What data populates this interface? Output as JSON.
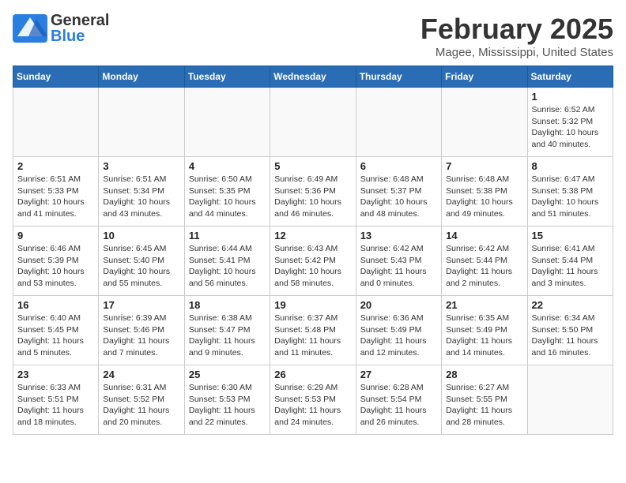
{
  "header": {
    "logo": {
      "general": "General",
      "blue": "Blue"
    },
    "title": "February 2025",
    "subtitle": "Magee, Mississippi, United States"
  },
  "weekdays": [
    "Sunday",
    "Monday",
    "Tuesday",
    "Wednesday",
    "Thursday",
    "Friday",
    "Saturday"
  ],
  "weeks": [
    [
      {
        "day": "",
        "info": ""
      },
      {
        "day": "",
        "info": ""
      },
      {
        "day": "",
        "info": ""
      },
      {
        "day": "",
        "info": ""
      },
      {
        "day": "",
        "info": ""
      },
      {
        "day": "",
        "info": ""
      },
      {
        "day": "1",
        "info": "Sunrise: 6:52 AM\nSunset: 5:32 PM\nDaylight: 10 hours and 40 minutes."
      }
    ],
    [
      {
        "day": "2",
        "info": "Sunrise: 6:51 AM\nSunset: 5:33 PM\nDaylight: 10 hours and 41 minutes."
      },
      {
        "day": "3",
        "info": "Sunrise: 6:51 AM\nSunset: 5:34 PM\nDaylight: 10 hours and 43 minutes."
      },
      {
        "day": "4",
        "info": "Sunrise: 6:50 AM\nSunset: 5:35 PM\nDaylight: 10 hours and 44 minutes."
      },
      {
        "day": "5",
        "info": "Sunrise: 6:49 AM\nSunset: 5:36 PM\nDaylight: 10 hours and 46 minutes."
      },
      {
        "day": "6",
        "info": "Sunrise: 6:48 AM\nSunset: 5:37 PM\nDaylight: 10 hours and 48 minutes."
      },
      {
        "day": "7",
        "info": "Sunrise: 6:48 AM\nSunset: 5:38 PM\nDaylight: 10 hours and 49 minutes."
      },
      {
        "day": "8",
        "info": "Sunrise: 6:47 AM\nSunset: 5:38 PM\nDaylight: 10 hours and 51 minutes."
      }
    ],
    [
      {
        "day": "9",
        "info": "Sunrise: 6:46 AM\nSunset: 5:39 PM\nDaylight: 10 hours and 53 minutes."
      },
      {
        "day": "10",
        "info": "Sunrise: 6:45 AM\nSunset: 5:40 PM\nDaylight: 10 hours and 55 minutes."
      },
      {
        "day": "11",
        "info": "Sunrise: 6:44 AM\nSunset: 5:41 PM\nDaylight: 10 hours and 56 minutes."
      },
      {
        "day": "12",
        "info": "Sunrise: 6:43 AM\nSunset: 5:42 PM\nDaylight: 10 hours and 58 minutes."
      },
      {
        "day": "13",
        "info": "Sunrise: 6:42 AM\nSunset: 5:43 PM\nDaylight: 11 hours and 0 minutes."
      },
      {
        "day": "14",
        "info": "Sunrise: 6:42 AM\nSunset: 5:44 PM\nDaylight: 11 hours and 2 minutes."
      },
      {
        "day": "15",
        "info": "Sunrise: 6:41 AM\nSunset: 5:44 PM\nDaylight: 11 hours and 3 minutes."
      }
    ],
    [
      {
        "day": "16",
        "info": "Sunrise: 6:40 AM\nSunset: 5:45 PM\nDaylight: 11 hours and 5 minutes."
      },
      {
        "day": "17",
        "info": "Sunrise: 6:39 AM\nSunset: 5:46 PM\nDaylight: 11 hours and 7 minutes."
      },
      {
        "day": "18",
        "info": "Sunrise: 6:38 AM\nSunset: 5:47 PM\nDaylight: 11 hours and 9 minutes."
      },
      {
        "day": "19",
        "info": "Sunrise: 6:37 AM\nSunset: 5:48 PM\nDaylight: 11 hours and 11 minutes."
      },
      {
        "day": "20",
        "info": "Sunrise: 6:36 AM\nSunset: 5:49 PM\nDaylight: 11 hours and 12 minutes."
      },
      {
        "day": "21",
        "info": "Sunrise: 6:35 AM\nSunset: 5:49 PM\nDaylight: 11 hours and 14 minutes."
      },
      {
        "day": "22",
        "info": "Sunrise: 6:34 AM\nSunset: 5:50 PM\nDaylight: 11 hours and 16 minutes."
      }
    ],
    [
      {
        "day": "23",
        "info": "Sunrise: 6:33 AM\nSunset: 5:51 PM\nDaylight: 11 hours and 18 minutes."
      },
      {
        "day": "24",
        "info": "Sunrise: 6:31 AM\nSunset: 5:52 PM\nDaylight: 11 hours and 20 minutes."
      },
      {
        "day": "25",
        "info": "Sunrise: 6:30 AM\nSunset: 5:53 PM\nDaylight: 11 hours and 22 minutes."
      },
      {
        "day": "26",
        "info": "Sunrise: 6:29 AM\nSunset: 5:53 PM\nDaylight: 11 hours and 24 minutes."
      },
      {
        "day": "27",
        "info": "Sunrise: 6:28 AM\nSunset: 5:54 PM\nDaylight: 11 hours and 26 minutes."
      },
      {
        "day": "28",
        "info": "Sunrise: 6:27 AM\nSunset: 5:55 PM\nDaylight: 11 hours and 28 minutes."
      },
      {
        "day": "",
        "info": ""
      }
    ]
  ]
}
